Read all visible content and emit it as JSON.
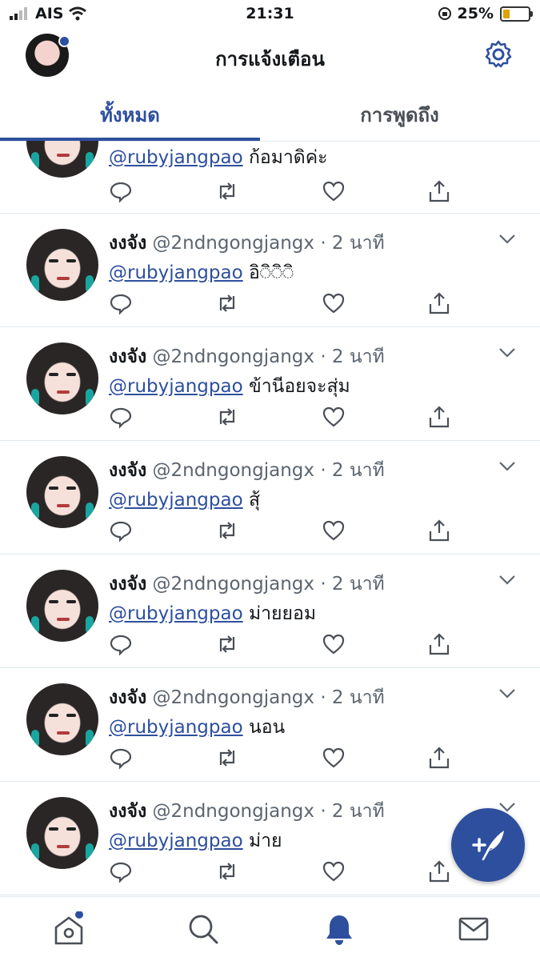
{
  "status_bar": {
    "carrier": "AIS",
    "time": "21:31",
    "battery": "25%"
  },
  "header": {
    "title": "การแจ้งเตือน"
  },
  "tabs": [
    {
      "label": "ทั้งหมด",
      "active": true
    },
    {
      "label": "การพูดถึง",
      "active": false
    }
  ],
  "tweets": [
    {
      "name": "",
      "handle": "",
      "time": "",
      "mention": "@rubyjangpao",
      "text": "ก้อมาดิค่ะ"
    },
    {
      "name": "งงจัง",
      "handle": "@2ndngongjangx",
      "time": "· 2 นาที",
      "mention": "@rubyjangpao",
      "text": "อิ◌ิ◌ิ◌ิ"
    },
    {
      "name": "งงจัง",
      "handle": "@2ndngongjangx",
      "time": "· 2 นาที",
      "mention": "@rubyjangpao",
      "text": "ข้านีอยจะสุ่ม"
    },
    {
      "name": "งงจัง",
      "handle": "@2ndngongjangx",
      "time": "· 2 นาที",
      "mention": "@rubyjangpao",
      "text": "สุ้"
    },
    {
      "name": "งงจัง",
      "handle": "@2ndngongjangx",
      "time": "· 2 นาที",
      "mention": "@rubyjangpao",
      "text": "ม่ายยอม"
    },
    {
      "name": "งงจัง",
      "handle": "@2ndngongjangx",
      "time": "· 2 นาที",
      "mention": "@rubyjangpao",
      "text": "นอน"
    },
    {
      "name": "งงจัง",
      "handle": "@2ndngongjangx",
      "time": "· 2 นาที",
      "mention": "@rubyjangpao",
      "text": "ม่าย"
    }
  ],
  "colors": {
    "accent": "#2d4f9e",
    "text": "#14171a",
    "muted": "#5b6570",
    "divider": "#e1e8ed"
  },
  "icons": {
    "actions": [
      "reply-icon",
      "retweet-icon",
      "like-icon",
      "share-icon"
    ],
    "nav": [
      "home-icon",
      "search-icon",
      "notifications-icon",
      "messages-icon"
    ],
    "fab": "compose-tweet-icon"
  }
}
